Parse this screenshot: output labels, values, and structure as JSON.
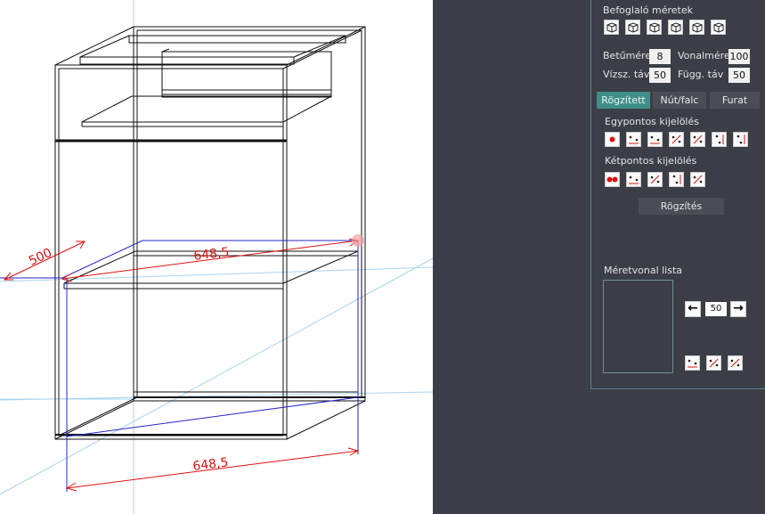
{
  "colors": {
    "accent": "#3f8f89",
    "dimension": "#e01010",
    "guide": "#2020c0",
    "panel_bg": "#3b3d47"
  },
  "viewport": {
    "dimensions": {
      "depth": "500",
      "width_top": "648,5",
      "width_bottom": "648,5"
    }
  },
  "panel": {
    "bounding_section_title": "Befoglaló méretek",
    "bounding_icons": [
      "cube-front-width-icon",
      "cube-top-width-icon",
      "cube-depth-icon",
      "cube-diagonal-icon",
      "cube-height-icon",
      "cube-right-height-icon"
    ],
    "font_size_label": "Betűméret",
    "font_size_value": "8",
    "line_size_label": "Vonalméret",
    "line_size_value": "100",
    "h_dist_label": "Vízsz. táv",
    "h_dist_value": "50",
    "v_dist_label": "Függ. táv",
    "v_dist_value": "50",
    "tabs": [
      "Rögzített",
      "Nút/falc",
      "Furat"
    ],
    "single_point_title": "Egypontos kijelölés",
    "single_point_icons": [
      "point-icon",
      "point-horizontal-icon",
      "point-horizontal-top-icon",
      "point-diagonal-icon",
      "point-diagonal-left-icon",
      "point-vertical-icon",
      "point-vertical-right-icon"
    ],
    "two_point_title": "Kétpontos kijelölés",
    "two_point_icons": [
      "two-points-icon",
      "two-point-horizontal-icon",
      "two-point-diagonal-icon",
      "two-point-vertical-icon",
      "two-point-aligned-icon"
    ],
    "record_button": "Rögzítés",
    "dim_list_title": "Méretvonal lista",
    "step_value": "50",
    "list_action_icons": [
      "merge-icon",
      "delete-icon",
      "delete-all-icon"
    ]
  }
}
